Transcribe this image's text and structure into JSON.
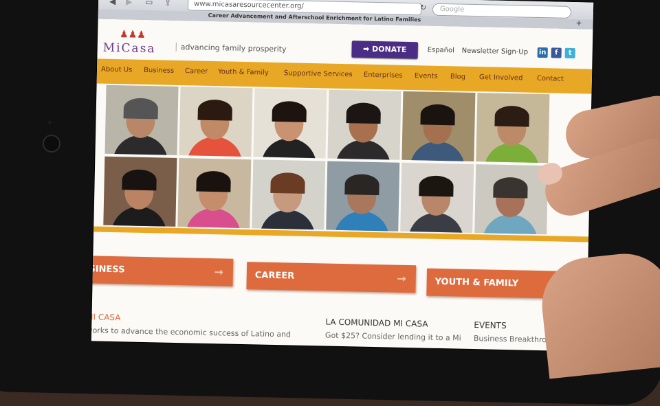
{
  "browser": {
    "url": "www.micasaresourcecenter.org/",
    "search_placeholder": "Google",
    "tab_title": "Career Advancement and Afterschool Enrichment for Latino Families",
    "new_tab_label": "+"
  },
  "site": {
    "logo_text": "MiCasa",
    "tagline": "advancing family prosperity",
    "donate_label": "DONATE",
    "espanol_label": "Español",
    "newsletter_label": "Newsletter Sign-Up",
    "social": [
      {
        "name": "linkedin",
        "label": "in",
        "color": "#2a6fa8"
      },
      {
        "name": "facebook",
        "label": "f",
        "color": "#3b5998"
      },
      {
        "name": "twitter",
        "label": "t",
        "color": "#3fb0d9"
      }
    ],
    "accent": "#e8a825",
    "brand_purple": "#4b2d86",
    "promo_orange": "#de6b3e"
  },
  "nav": [
    "About Us",
    "Business",
    "Career",
    "Youth & Family",
    "Supportive Services",
    "Enterprises",
    "Events",
    "Blog",
    "Get Involved",
    "Contact"
  ],
  "promos": [
    "BUSINESS",
    "CAREER",
    "YOUTH & FAMILY"
  ],
  "columns": {
    "about_heading": "ABOUT MI CASA",
    "about_text": "Mi Casa works to advance the economic success of Latino and",
    "comunidad_heading": "LA COMUNIDAD MI CASA",
    "comunidad_text": "Got $25? Consider lending it to a Mi",
    "events_heading": "EVENTS",
    "events_text": "Business Breakthrough: next-level"
  }
}
